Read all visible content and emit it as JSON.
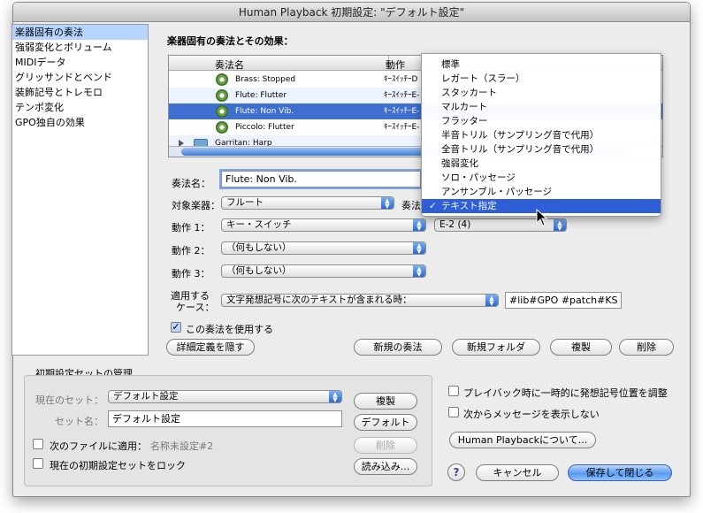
{
  "window": {
    "title": "Human Playback 初期設定: \"デフォルト設定\""
  },
  "sidebar": {
    "items": [
      {
        "label": "楽器固有の奏法",
        "selected": true
      },
      {
        "label": "強弱変化とボリューム"
      },
      {
        "label": "MIDIデータ"
      },
      {
        "label": "グリッサンドとベンド"
      },
      {
        "label": "装飾記号とトレモロ"
      },
      {
        "label": "テンポ変化"
      },
      {
        "label": "GPO独自の効果"
      }
    ]
  },
  "main": {
    "section_title": "楽器固有の奏法とその効果：",
    "table": {
      "columns": [
        "奏法名",
        "動作"
      ],
      "rows": [
        {
          "name": "Brass: Stopped",
          "action": "ｷｰｽｲｯﾁｰD",
          "icon": "gear-icon"
        },
        {
          "name": "Flute: Flutter",
          "action": "ｷｰｽｲｯﾁｰE-",
          "icon": "gear-icon"
        },
        {
          "name": "Flute: Non Vib.",
          "action": "ｷｰｽｲｯﾁｰE-",
          "icon": "gear-icon",
          "selected": true
        },
        {
          "name": "Piccolo: Flutter",
          "action": "ｷｰｽｲｯﾁｰE-",
          "icon": "gear-icon"
        },
        {
          "name": "Garritan: Harp",
          "action": "",
          "icon": "folder-icon"
        }
      ]
    },
    "technique_name_label": "奏法名：",
    "technique_name_value": "Flute: Non Vib.",
    "instrument_label": "対象楽器：",
    "instrument_value": "フルート",
    "technique_type_label": "奏法",
    "action1_label": "動作 1：",
    "action1_value": "キー・スイッチ",
    "action1_note": "E-2 (4)",
    "action2_label": "動作 2：",
    "action2_value": "（何もしない）",
    "action3_label": "動作 3：",
    "action3_value": "（何もしない）",
    "apply_case_label_1": "適用する",
    "apply_case_label_2": "ケース：",
    "apply_case_value": "文字発想記号に次のテキストが含まれる時：",
    "apply_case_text": "#lib#GPO #patch#KS",
    "use_technique_label": "この奏法を使用する",
    "use_technique_checked": true,
    "buttons": {
      "hide_details": "詳細定義を隠す",
      "new_technique": "新規の奏法",
      "new_folder": "新規フォルダ",
      "duplicate": "複製",
      "delete": "削除"
    }
  },
  "presets": {
    "title": "初期設定セットの管理",
    "current_set_label": "現在のセット：",
    "current_set_value": "デフォルト設定",
    "set_name_label": "セット名：",
    "set_name_value": "デフォルト設定",
    "apply_to_file_label": "次のファイルに適用：",
    "apply_to_file_value": "名称未設定#2",
    "lock_label": "現在の初期設定セットをロック",
    "buttons": {
      "duplicate": "複製",
      "default": "デフォルト",
      "delete": "削除",
      "load": "読み込み..."
    }
  },
  "options": {
    "adjust_position_label": "プレイバック時に一時的に発想記号位置を調整",
    "show_messages_label": "次からメッセージを表示しない",
    "about_button": "Human Playbackについて...",
    "help_symbol": "?",
    "cancel_button": "キャンセル",
    "save_close_button": "保存して閉じる"
  },
  "dropdown_menu": {
    "check_symbol": "✓",
    "items": [
      {
        "label": "標準"
      },
      {
        "label": "レガート（スラー）"
      },
      {
        "label": "スタッカート"
      },
      {
        "label": "マルカート"
      },
      {
        "label": "フラッター"
      },
      {
        "label": "半音トリル（サンプリング音で代用）"
      },
      {
        "label": "全音トリル（サンプリング音で代用）"
      },
      {
        "label": "強弱変化"
      },
      {
        "label": "ソロ・パッセージ"
      },
      {
        "label": "アンサンブル・パッセージ"
      },
      {
        "label": "テキスト指定",
        "selected": true
      }
    ]
  }
}
